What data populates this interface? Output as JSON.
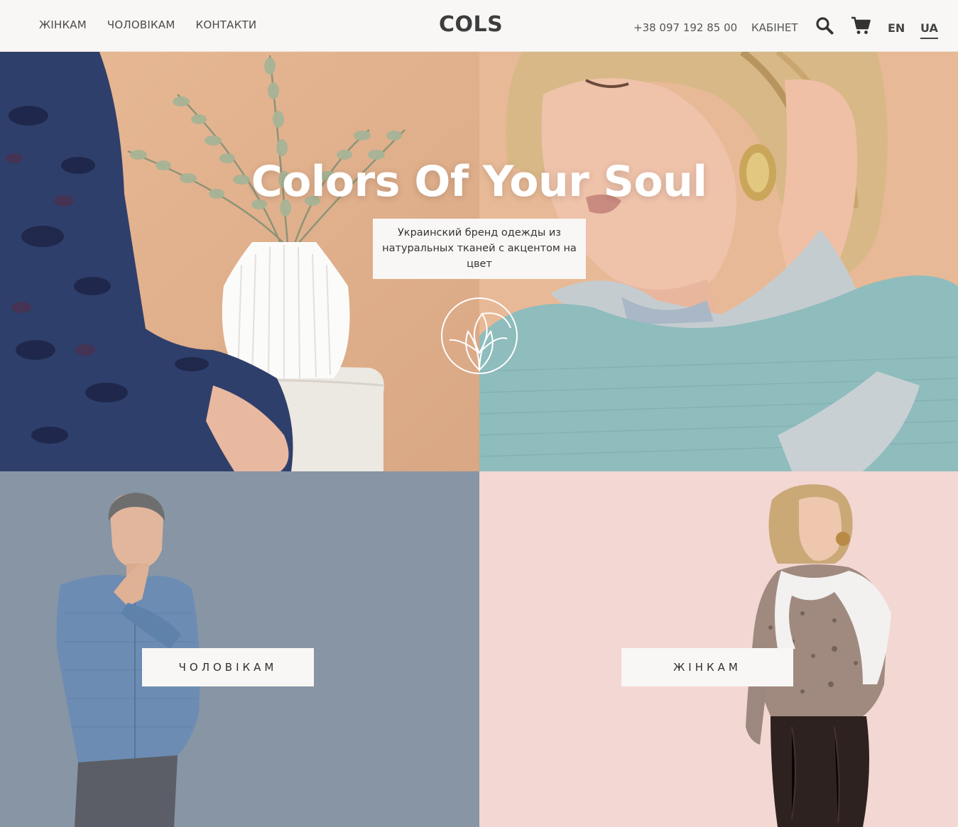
{
  "header": {
    "nav": [
      "ЖІНКАМ",
      "ЧОЛОВІКАМ",
      "КОНТАКТИ"
    ],
    "logo": "COLS",
    "phone": "+38 097 192 85 00",
    "cabinet": "КАБІНЕТ",
    "search_icon": "search-icon",
    "cart_icon": "cart-icon",
    "languages": [
      "EN",
      "UA"
    ],
    "active_language": "UA"
  },
  "hero": {
    "title": "Colors Of Your Soul",
    "tagline": "Украинский бренд одежды из натуральных тканей с акцентом на цвет",
    "emblem_icon": "flower-emblem-icon"
  },
  "categories": {
    "men": {
      "label": "ЧОЛОВІКАМ",
      "bg": "#8795a5"
    },
    "women": {
      "label": "ЖІНКАМ",
      "bg": "#f3d7d3"
    }
  },
  "colors": {
    "header_bg": "#f8f7f5",
    "hero_peach": "#e1b18d",
    "sweater_teal": "#8fbcbc"
  }
}
